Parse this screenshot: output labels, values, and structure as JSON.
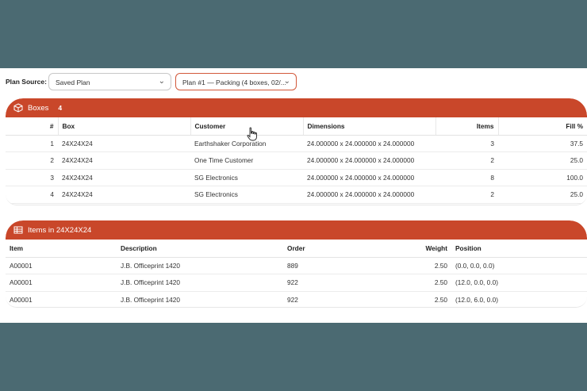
{
  "toolbar": {
    "plan_source_label": "Plan Source:",
    "plan_source_value": "Saved Plan",
    "plan_value": "Plan #1 — Packing (4 boxes, 02/..."
  },
  "boxes_panel": {
    "title": "Boxes",
    "count": "4",
    "columns": [
      "#",
      "Box",
      "Customer",
      "Dimensions",
      "Items",
      "Fill %"
    ],
    "rows": [
      [
        "1",
        "24X24X24",
        "Earthshaker Corporation",
        "24.000000 x 24.000000 x 24.000000",
        "3",
        "37.5"
      ],
      [
        "2",
        "24X24X24",
        "One Time Customer",
        "24.000000 x 24.000000 x 24.000000",
        "2",
        "25.0"
      ],
      [
        "3",
        "24X24X24",
        "SG Electronics",
        "24.000000 x 24.000000 x 24.000000",
        "8",
        "100.0"
      ],
      [
        "4",
        "24X24X24",
        "SG Electronics",
        "24.000000 x 24.000000 x 24.000000",
        "2",
        "25.0"
      ]
    ]
  },
  "items_panel": {
    "title": "Items in 24X24X24",
    "columns": [
      "Item",
      "Description",
      "Order",
      "Weight",
      "Position"
    ],
    "rows": [
      [
        "A00001",
        "J.B. Officeprint 1420",
        "889",
        "2.50",
        "(0.0, 0.0, 0.0)"
      ],
      [
        "A00001",
        "J.B. Officeprint 1420",
        "922",
        "2.50",
        "(12.0, 0.0, 0.0)"
      ],
      [
        "A00001",
        "J.B. Officeprint 1420",
        "922",
        "2.50",
        "(12.0, 6.0, 0.0)"
      ]
    ]
  },
  "colors": {
    "accent": "#c9472a",
    "backdrop": "#4b6a72"
  },
  "icons": {
    "boxes_panel": "cube-icon",
    "items_panel": "table-icon",
    "select": "chevron-down-icon",
    "pointer": "hand-pointer-icon"
  }
}
